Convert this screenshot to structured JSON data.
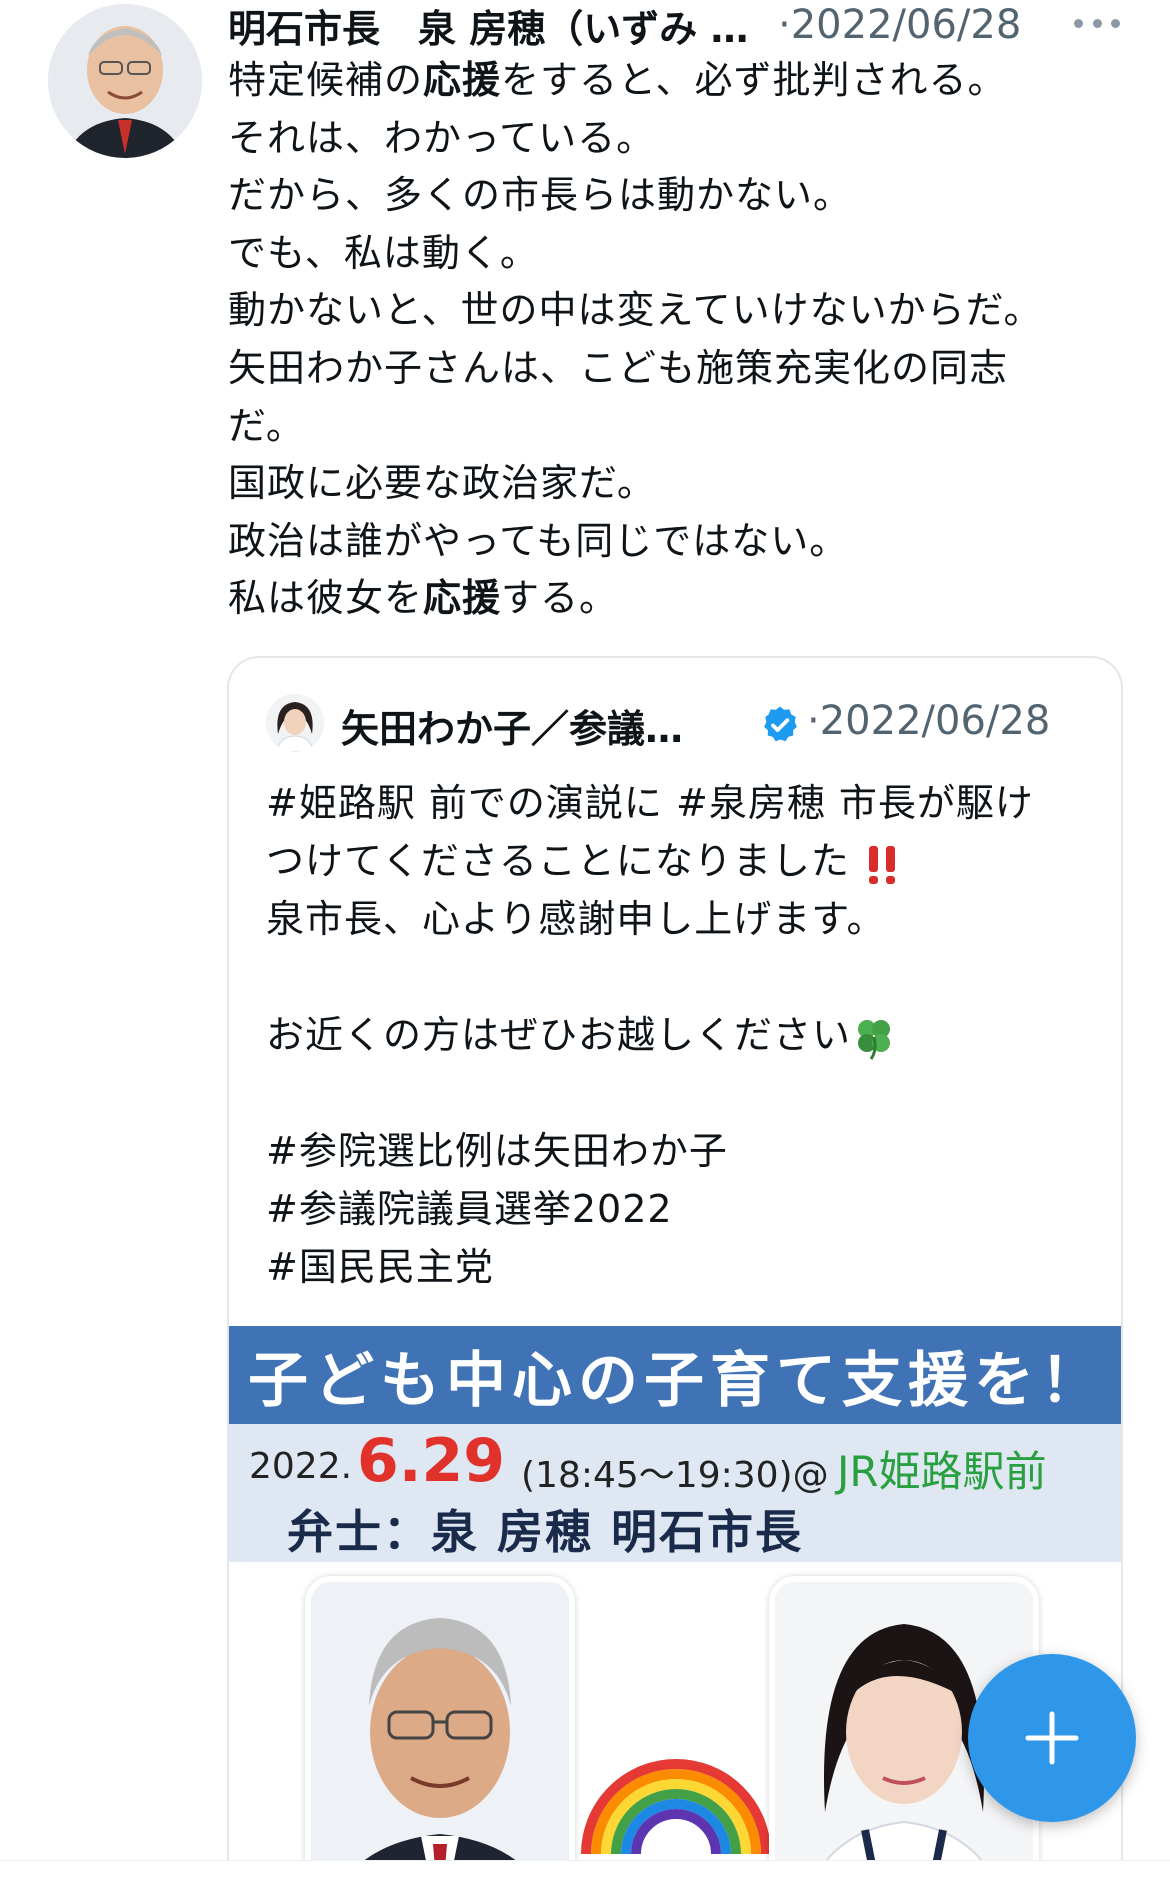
{
  "main_tweet": {
    "author": "明石市長　泉 房穂（いずみ ふさほ）",
    "date": "2022/06/28",
    "separator": "·",
    "lines": [
      {
        "parts": [
          "特定候補の",
          "応援",
          "をすると、必ず批判される。"
        ]
      },
      {
        "parts": [
          "それは、わかっている。"
        ]
      },
      {
        "parts": [
          "だから、多くの市長らは動かない。"
        ]
      },
      {
        "parts": [
          "でも、私は動く。"
        ]
      },
      {
        "parts": [
          "動かないと、世の中は変えていけないからだ。"
        ]
      },
      {
        "parts": [
          "矢田わか子さんは、こども施策充実化の同志"
        ]
      },
      {
        "parts": [
          "だ。"
        ]
      },
      {
        "parts": [
          "国政に必要な政治家だ。"
        ]
      },
      {
        "parts": [
          "政治は誰がやっても同じではない。"
        ]
      },
      {
        "parts": [
          "私は彼女を",
          "応援",
          "する。"
        ]
      }
    ]
  },
  "quoted_tweet": {
    "author": "矢田わか子／参議…",
    "date": "2022/06/28",
    "separator": "·",
    "lines": [
      "#姫路駅 前での演説に #泉房穂 市長が駆け",
      "つけてくださることになりました",
      "泉市長、心より感謝申し上げます。",
      "",
      "お近くの方はぜひお越しください",
      "",
      "#参院選比例は矢田わか子",
      "#参議院議員選挙2022",
      "#国民民主党"
    ],
    "emoji": {
      "exclamation": "double-exclamation-icon",
      "clover": "four-leaf-clover-icon"
    }
  },
  "flyer": {
    "banner": "子ども中心の子育て支援を！",
    "year": "2022.",
    "date": "6.29",
    "time": "(18:45〜19:30)@",
    "place": "JR姫路駅前",
    "speaker": "弁士：泉 房穂 明石市長"
  },
  "colors": {
    "banner_bg": "#3f73b6",
    "date_red": "#e0312b",
    "place_green": "#29a040",
    "fab_blue": "#2f97ea",
    "verified_blue": "#1d9bf0"
  }
}
